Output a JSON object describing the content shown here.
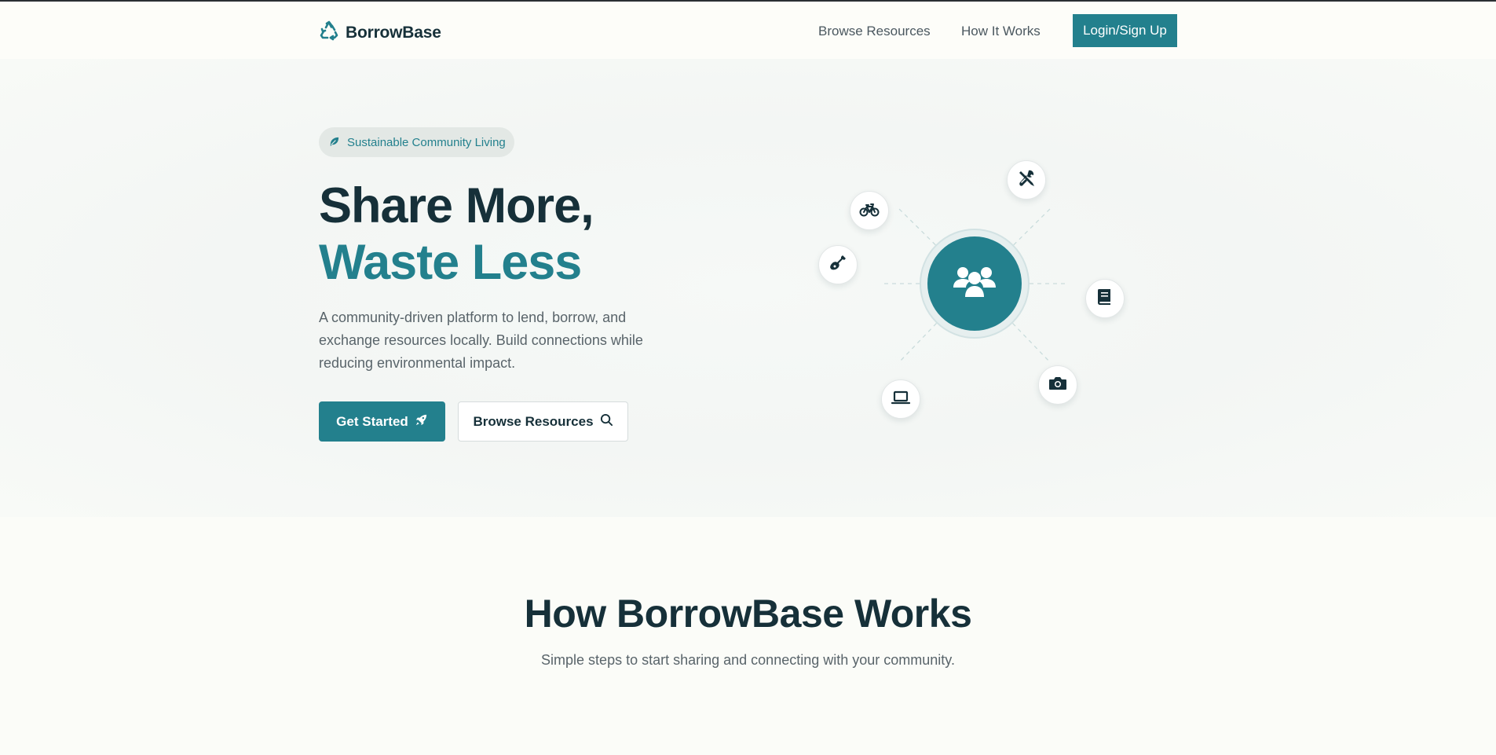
{
  "brand": {
    "name": "BorrowBase",
    "logo_icon": "recycle-icon",
    "accent": "#23808d",
    "dark": "#163039"
  },
  "nav": {
    "links": [
      "Browse Resources",
      "How It Works"
    ],
    "login_label": "Login/Sign Up"
  },
  "hero": {
    "badge": {
      "icon": "leaf-icon",
      "label": "Sustainable Community Living"
    },
    "title_line1": "Share More,",
    "title_line2": "Waste Less",
    "lead": "A community-driven platform to lend, borrow, and exchange resources locally. Build connections while reducing environmental impact.",
    "primary_button": {
      "label": "Get Started",
      "icon": "rocket-icon"
    },
    "secondary_button": {
      "label": "Browse Resources",
      "icon": "search-icon"
    }
  },
  "illustration": {
    "center_icon": "users-icon",
    "nodes": [
      "bicycle-icon",
      "tools-icon",
      "guitar-icon",
      "book-icon",
      "laptop-icon",
      "camera-icon"
    ]
  },
  "how_it_works": {
    "title": "How BorrowBase Works",
    "subtitle": "Simple steps to start sharing and connecting with your community."
  }
}
